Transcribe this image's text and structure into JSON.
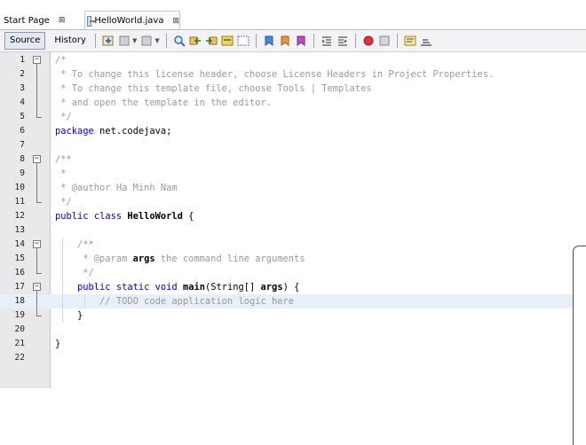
{
  "tabs": [
    {
      "label": "Start Page",
      "close": "⊠",
      "active": false
    },
    {
      "label": "HelloWorld.java",
      "close": "⊠",
      "active": true
    }
  ],
  "toolbar": {
    "source_label": "Source",
    "history_label": "History"
  },
  "editor": {
    "highlighted_line": 18,
    "lines": [
      {
        "num": "1",
        "text": "/*"
      },
      {
        "num": "2",
        "text": " * To change this license header, choose License Headers in Project Properties."
      },
      {
        "num": "3",
        "text": " * To change this template file, choose Tools | Templates"
      },
      {
        "num": "4",
        "text": " * and open the template in the editor."
      },
      {
        "num": "5",
        "text": " */"
      },
      {
        "num": "6",
        "text": "package net.codejava;"
      },
      {
        "num": "7",
        "text": ""
      },
      {
        "num": "8",
        "text": "/**"
      },
      {
        "num": "9",
        "text": " *"
      },
      {
        "num": "10",
        "text": " * @author Ha Minh Nam"
      },
      {
        "num": "11",
        "text": " */"
      },
      {
        "num": "12",
        "text": "public class HelloWorld {"
      },
      {
        "num": "13",
        "text": ""
      },
      {
        "num": "14",
        "text": "    /**"
      },
      {
        "num": "15",
        "text": "     * @param args the command line arguments"
      },
      {
        "num": "16",
        "text": "     */"
      },
      {
        "num": "17",
        "text": "    public static void main(String[] args) {"
      },
      {
        "num": "18",
        "text": "        // TODO code application logic here"
      },
      {
        "num": "19",
        "text": "    }"
      },
      {
        "num": "20",
        "text": ""
      },
      {
        "num": "21",
        "text": "}"
      },
      {
        "num": "22",
        "text": ""
      }
    ]
  }
}
